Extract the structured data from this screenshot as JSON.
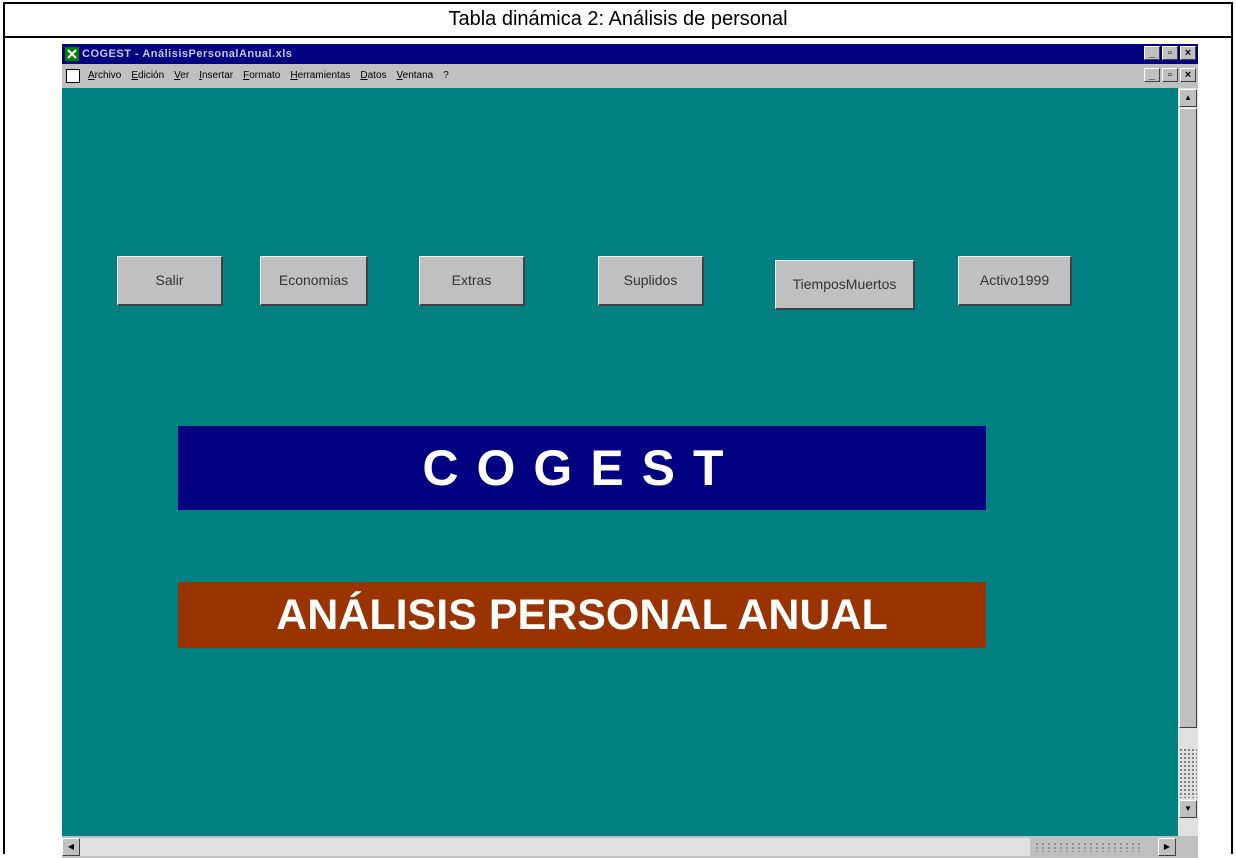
{
  "caption": "Tabla dinámica 2: Análisis de personal",
  "window": {
    "title": "COGEST - AnálisisPersonalAnual.xls",
    "buttons": [
      "_",
      "▫",
      "×"
    ]
  },
  "menubar": {
    "items": [
      "Archivo",
      "Edición",
      "Ver",
      "Insertar",
      "Formato",
      "Herramientas",
      "Datos",
      "Ventana",
      "?"
    ]
  },
  "sheet": {
    "buttons": [
      "Salir",
      "Economias",
      "Extras",
      "Suplidos",
      "TiemposMuertos",
      "Activo1999"
    ],
    "banner_title": "COGEST",
    "banner_subtitle": "ANÁLISIS PERSONAL ANUAL"
  },
  "colors": {
    "sheet_bg": "#008080",
    "title_banner": "#000080",
    "subtitle_banner": "#993300",
    "titlebar": "#000080"
  }
}
